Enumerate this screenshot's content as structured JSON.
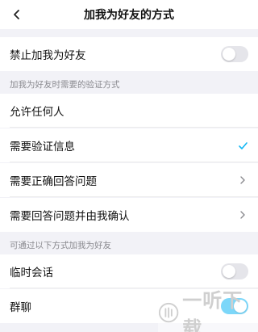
{
  "header": {
    "title": "加我为好友的方式",
    "back_icon": "chevron-left-icon"
  },
  "block_add": {
    "label": "禁止加我为好友",
    "toggle_on": false
  },
  "verify_section": {
    "header": "加我为好友时需要的验证方式",
    "options": [
      {
        "label": "允许任何人",
        "selected": false,
        "trailing": "none"
      },
      {
        "label": "需要验证信息",
        "selected": true,
        "trailing": "checkmark-icon"
      },
      {
        "label": "需要正确回答问题",
        "selected": false,
        "trailing": "chevron-right-icon"
      },
      {
        "label": "需要回答问题并由我确认",
        "selected": false,
        "trailing": "chevron-right-icon"
      }
    ]
  },
  "via_section": {
    "header": "可通过以下方式加我为好友",
    "items": [
      {
        "label": "临时会话",
        "toggle_on": false
      },
      {
        "label": "群聊",
        "toggle_on": true
      }
    ]
  },
  "colors": {
    "accent": "#12b7f5",
    "background": "#f2f2f7",
    "toggle_off": "#e5e5ea"
  },
  "watermark": {
    "text": "一听下载"
  }
}
